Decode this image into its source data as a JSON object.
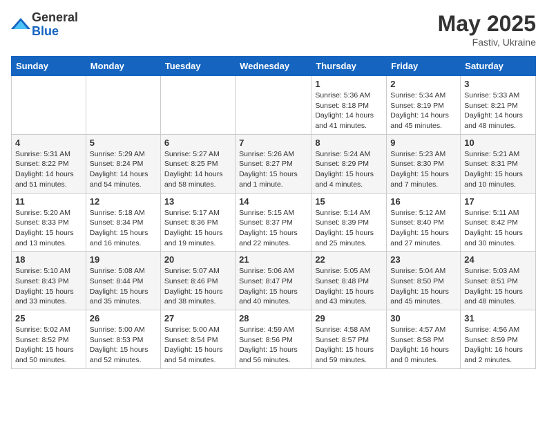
{
  "header": {
    "logo_general": "General",
    "logo_blue": "Blue",
    "month_year": "May 2025",
    "location": "Fastiv, Ukraine"
  },
  "weekdays": [
    "Sunday",
    "Monday",
    "Tuesday",
    "Wednesday",
    "Thursday",
    "Friday",
    "Saturday"
  ],
  "weeks": [
    [
      null,
      null,
      null,
      null,
      {
        "day": "1",
        "sunrise": "5:36 AM",
        "sunset": "8:18 PM",
        "daylight": "14 hours and 41 minutes."
      },
      {
        "day": "2",
        "sunrise": "5:34 AM",
        "sunset": "8:19 PM",
        "daylight": "14 hours and 45 minutes."
      },
      {
        "day": "3",
        "sunrise": "5:33 AM",
        "sunset": "8:21 PM",
        "daylight": "14 hours and 48 minutes."
      }
    ],
    [
      {
        "day": "4",
        "sunrise": "5:31 AM",
        "sunset": "8:22 PM",
        "daylight": "14 hours and 51 minutes."
      },
      {
        "day": "5",
        "sunrise": "5:29 AM",
        "sunset": "8:24 PM",
        "daylight": "14 hours and 54 minutes."
      },
      {
        "day": "6",
        "sunrise": "5:27 AM",
        "sunset": "8:25 PM",
        "daylight": "14 hours and 58 minutes."
      },
      {
        "day": "7",
        "sunrise": "5:26 AM",
        "sunset": "8:27 PM",
        "daylight": "15 hours and 1 minute."
      },
      {
        "day": "8",
        "sunrise": "5:24 AM",
        "sunset": "8:29 PM",
        "daylight": "15 hours and 4 minutes."
      },
      {
        "day": "9",
        "sunrise": "5:23 AM",
        "sunset": "8:30 PM",
        "daylight": "15 hours and 7 minutes."
      },
      {
        "day": "10",
        "sunrise": "5:21 AM",
        "sunset": "8:31 PM",
        "daylight": "15 hours and 10 minutes."
      }
    ],
    [
      {
        "day": "11",
        "sunrise": "5:20 AM",
        "sunset": "8:33 PM",
        "daylight": "15 hours and 13 minutes."
      },
      {
        "day": "12",
        "sunrise": "5:18 AM",
        "sunset": "8:34 PM",
        "daylight": "15 hours and 16 minutes."
      },
      {
        "day": "13",
        "sunrise": "5:17 AM",
        "sunset": "8:36 PM",
        "daylight": "15 hours and 19 minutes."
      },
      {
        "day": "14",
        "sunrise": "5:15 AM",
        "sunset": "8:37 PM",
        "daylight": "15 hours and 22 minutes."
      },
      {
        "day": "15",
        "sunrise": "5:14 AM",
        "sunset": "8:39 PM",
        "daylight": "15 hours and 25 minutes."
      },
      {
        "day": "16",
        "sunrise": "5:12 AM",
        "sunset": "8:40 PM",
        "daylight": "15 hours and 27 minutes."
      },
      {
        "day": "17",
        "sunrise": "5:11 AM",
        "sunset": "8:42 PM",
        "daylight": "15 hours and 30 minutes."
      }
    ],
    [
      {
        "day": "18",
        "sunrise": "5:10 AM",
        "sunset": "8:43 PM",
        "daylight": "15 hours and 33 minutes."
      },
      {
        "day": "19",
        "sunrise": "5:08 AM",
        "sunset": "8:44 PM",
        "daylight": "15 hours and 35 minutes."
      },
      {
        "day": "20",
        "sunrise": "5:07 AM",
        "sunset": "8:46 PM",
        "daylight": "15 hours and 38 minutes."
      },
      {
        "day": "21",
        "sunrise": "5:06 AM",
        "sunset": "8:47 PM",
        "daylight": "15 hours and 40 minutes."
      },
      {
        "day": "22",
        "sunrise": "5:05 AM",
        "sunset": "8:48 PM",
        "daylight": "15 hours and 43 minutes."
      },
      {
        "day": "23",
        "sunrise": "5:04 AM",
        "sunset": "8:50 PM",
        "daylight": "15 hours and 45 minutes."
      },
      {
        "day": "24",
        "sunrise": "5:03 AM",
        "sunset": "8:51 PM",
        "daylight": "15 hours and 48 minutes."
      }
    ],
    [
      {
        "day": "25",
        "sunrise": "5:02 AM",
        "sunset": "8:52 PM",
        "daylight": "15 hours and 50 minutes."
      },
      {
        "day": "26",
        "sunrise": "5:00 AM",
        "sunset": "8:53 PM",
        "daylight": "15 hours and 52 minutes."
      },
      {
        "day": "27",
        "sunrise": "5:00 AM",
        "sunset": "8:54 PM",
        "daylight": "15 hours and 54 minutes."
      },
      {
        "day": "28",
        "sunrise": "4:59 AM",
        "sunset": "8:56 PM",
        "daylight": "15 hours and 56 minutes."
      },
      {
        "day": "29",
        "sunrise": "4:58 AM",
        "sunset": "8:57 PM",
        "daylight": "15 hours and 59 minutes."
      },
      {
        "day": "30",
        "sunrise": "4:57 AM",
        "sunset": "8:58 PM",
        "daylight": "16 hours and 0 minutes."
      },
      {
        "day": "31",
        "sunrise": "4:56 AM",
        "sunset": "8:59 PM",
        "daylight": "16 hours and 2 minutes."
      }
    ]
  ],
  "labels": {
    "sunrise": "Sunrise:",
    "sunset": "Sunset:",
    "daylight": "Daylight:"
  }
}
